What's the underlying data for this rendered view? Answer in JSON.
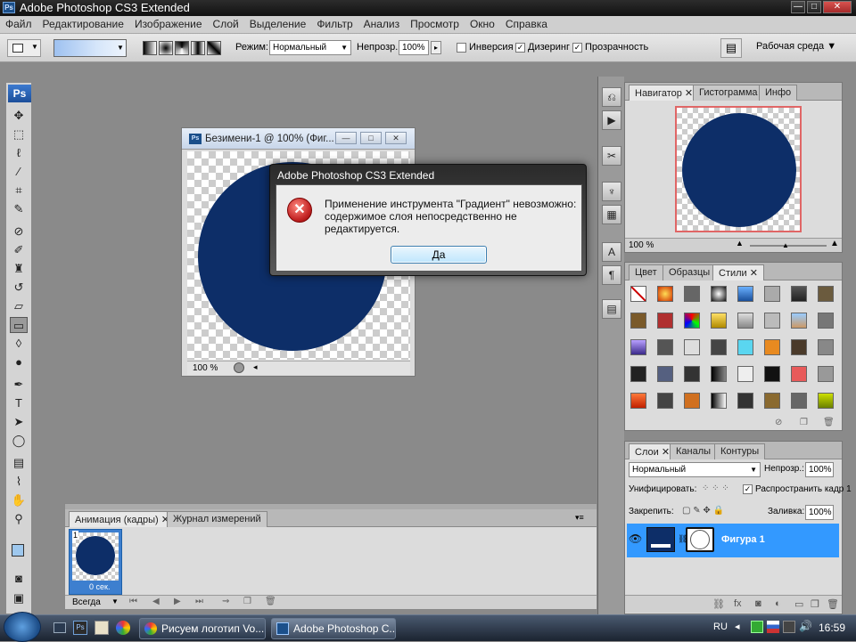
{
  "app": {
    "title": "Adobe Photoshop CS3 Extended",
    "icon": "Ps"
  },
  "window_controls": {
    "minimize": "—",
    "maximize": "□",
    "close": "✕"
  },
  "menu": [
    "Файл",
    "Редактирование",
    "Изображение",
    "Слой",
    "Выделение",
    "Фильтр",
    "Анализ",
    "Просмотр",
    "Окно",
    "Справка"
  ],
  "options": {
    "mode_label": "Режим:",
    "mode_value": "Нормальный",
    "opacity_label": "Непрозр.:",
    "opacity_value": "100%",
    "invert_label": "Инверсия",
    "dither_label": "Дизеринг",
    "transparency_label": "Прозрачность",
    "workspace_label": "Рабочая среда ▼"
  },
  "toolbox": {
    "logo": "Ps"
  },
  "document": {
    "title": "Безимени-1 @ 100% (Фиг...",
    "zoom": "100 %",
    "fill_color": "#0d2e68"
  },
  "dialog": {
    "title": "Adobe Photoshop CS3 Extended",
    "line1": "Применение инструмента \"Градиент\" невозможно:",
    "line2": "содержимое слоя непосредственно не",
    "line3": "редактируется.",
    "ok": "Да"
  },
  "animation": {
    "tabs": [
      "Анимация (кадры)",
      "Журнал измерений"
    ],
    "frame_number": "1",
    "frame_delay": "0 сек.",
    "loop": "Всегда"
  },
  "navigator": {
    "tabs": [
      "Навигатор",
      "Гистограмма",
      "Инфо"
    ],
    "zoom": "100 %"
  },
  "styles": {
    "tabs": [
      "Цвет",
      "Образцы",
      "Стили"
    ]
  },
  "layers": {
    "tabs": [
      "Слои",
      "Каналы",
      "Контуры"
    ],
    "blend": "Нормальный",
    "opacity_label": "Непрозр.:",
    "opacity_value": "100%",
    "unify_label": "Унифицировать:",
    "propagate_label": "Распространить кадр 1",
    "lock_label": "Закрепить:",
    "fill_label": "Заливка:",
    "fill_value": "100%",
    "layer_name": "Фигура 1"
  },
  "taskbar": {
    "tasks": [
      "Рисуем логотип Vo...",
      "Adobe Photoshop C..."
    ],
    "lang": "RU",
    "clock": "16:59"
  },
  "colors": {
    "accent_blue": "#3399ff",
    "shape_fill": "#0d2e68",
    "error_red": "#c62828"
  }
}
